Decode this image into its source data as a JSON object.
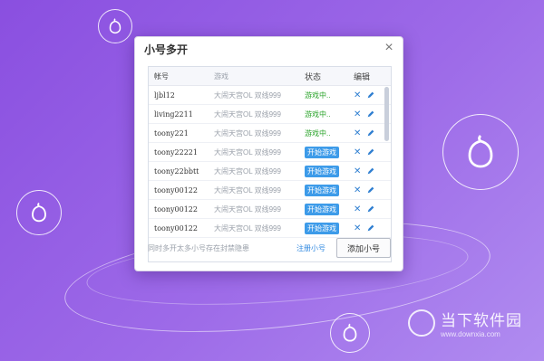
{
  "dialog": {
    "title": "小号多开",
    "close_symbol": "×",
    "columns": [
      "帐号",
      "游戏",
      "状态",
      "编辑"
    ],
    "rows": [
      {
        "account": "ljbl12",
        "game": "大闹天宫OL 双线999",
        "status": "游戏中..",
        "status_type": "playing"
      },
      {
        "account": "living2211",
        "game": "大闹天宫OL 双线999",
        "status": "游戏中..",
        "status_type": "playing"
      },
      {
        "account": "toony221",
        "game": "大闹天宫OL 双线999",
        "status": "游戏中..",
        "status_type": "playing"
      },
      {
        "account": "toony22221",
        "game": "大闹天宫OL 双线999",
        "status": "开始游戏",
        "status_type": "start"
      },
      {
        "account": "toony22bbtt",
        "game": "大闹天宫OL 双线999",
        "status": "开始游戏",
        "status_type": "start"
      },
      {
        "account": "toony00122",
        "game": "大闹天宫OL 双线999",
        "status": "开始游戏",
        "status_type": "start"
      },
      {
        "account": "toony00122",
        "game": "大闹天宫OL 双线999",
        "status": "开始游戏",
        "status_type": "start"
      },
      {
        "account": "toony00122",
        "game": "大闹天宫OL 双线999",
        "status": "开始游戏",
        "status_type": "start"
      }
    ],
    "footer_note": "同时多开太多小号存在封禁隐患",
    "register_link": "注册小号",
    "add_button": "添加小号"
  },
  "watermark": {
    "text_cn": "当下软件园",
    "url": "www.downxia.com"
  },
  "icons": {
    "delete": "x-icon",
    "edit": "pencil-icon",
    "logo": "gourd-logo-icon"
  },
  "colors": {
    "background": "#9d6ae8",
    "playing_status": "#29a329",
    "start_button": "#3d9be9",
    "link": "#2f88e0"
  }
}
